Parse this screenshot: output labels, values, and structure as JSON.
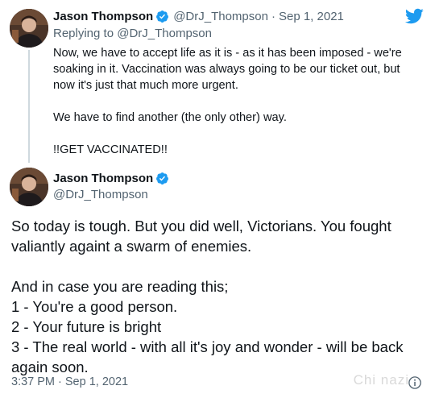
{
  "reply_tweet": {
    "author_name": "Jason Thompson",
    "author_handle": "@DrJ_Thompson",
    "separator": "·",
    "date": "Sep 1, 2021",
    "replying_to_label": "Replying to",
    "replying_to_handle": "@DrJ_Thompson",
    "paragraphs": [
      "Now, we have to accept life as it is - as it has been imposed - we're soaking in it. Vaccination was always going to be our ticket out, but now it's just that much more urgent.",
      "We have to find another (the only other) way.",
      "!!GET VACCINATED!!"
    ]
  },
  "main_tweet": {
    "author_name": "Jason Thompson",
    "author_handle": "@DrJ_Thompson",
    "line1": "So today is tough. But you did well, Victorians. You fought valiantly againt a swarm of enemies.",
    "line2": "And in case you are reading this;",
    "line3": "1 - You're a good person.",
    "line4": "2 - Your future is bright",
    "line5": "3 - The real world - with all it's joy and wonder - will be back again soon.",
    "timestamp": "3:37 PM · Sep 1, 2021"
  },
  "watermark": "Chi nazi",
  "icons": {
    "verified": "verified-badge-icon",
    "twitter": "twitter-bird-icon",
    "info": "info-icon"
  },
  "colors": {
    "twitter_blue": "#1d9bf0",
    "text_primary": "#0f1419",
    "text_secondary": "#536471",
    "thread_line": "#cfd9de"
  }
}
